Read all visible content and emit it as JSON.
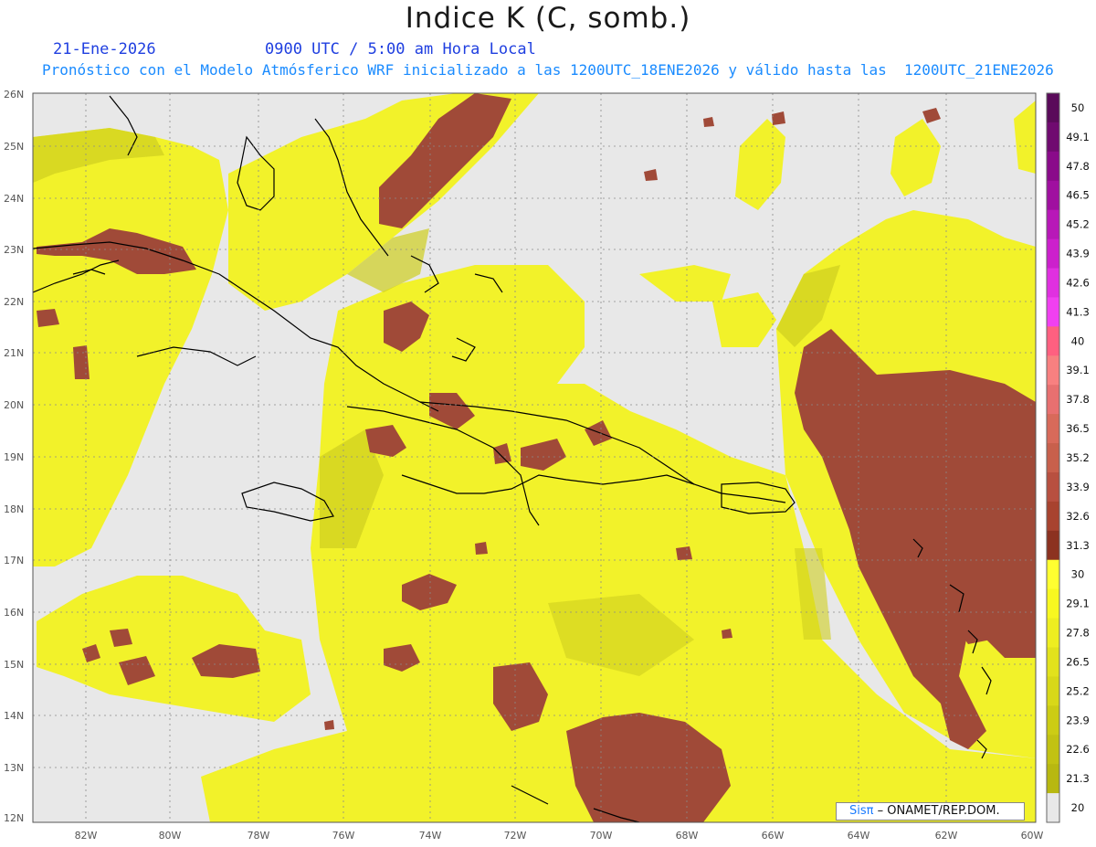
{
  "header": {
    "title": "Indice K (C, somb.)",
    "date": "21-Ene-2026",
    "time": "0900 UTC / 5:00 am Hora Local",
    "subtitle": "Pronóstico con el Modelo Atmósferico WRF inicializado a las 1200UTC_18ENE2026 y válido hasta las  1200UTC_21ENE2026"
  },
  "axes": {
    "lon_labels": [
      "82W",
      "80W",
      "78W",
      "76W",
      "74W",
      "72W",
      "70W",
      "68W",
      "66W",
      "64W",
      "62W",
      "60W"
    ],
    "lat_labels": [
      "26N",
      "25N",
      "24N",
      "23N",
      "22N",
      "21N",
      "20N",
      "19N",
      "18N",
      "17N",
      "16N",
      "15N",
      "14N",
      "13N",
      "12N"
    ]
  },
  "colorbar": {
    "labels": [
      "50",
      "49.1",
      "47.8",
      "46.5",
      "45.2",
      "43.9",
      "42.6",
      "41.3",
      "40",
      "39.1",
      "37.8",
      "36.5",
      "35.2",
      "33.9",
      "32.6",
      "31.3",
      "30",
      "29.1",
      "27.8",
      "26.5",
      "25.2",
      "23.9",
      "22.6",
      "21.3",
      "20"
    ],
    "colors_top_to_bottom": [
      "#5a0a5a",
      "#700a70",
      "#8a0a8a",
      "#a010a0",
      "#b818b8",
      "#cc20cc",
      "#e030e0",
      "#f040f0",
      "#ff6080",
      "#f88080",
      "#e87070",
      "#d86a5a",
      "#c8604c",
      "#b85040",
      "#a8432f",
      "#8c3220",
      "#ffff30",
      "#f8f820",
      "#eeee20",
      "#e2e21c",
      "#d8d818",
      "#cccc14",
      "#c2c212",
      "#b8b810",
      "#e8e8e8"
    ]
  },
  "colors": {
    "background": "#e8e8e8",
    "yellow": "#f2f22a",
    "olive": "#cfcf20",
    "brown": "#a04a38",
    "coast": "#000000"
  },
  "credit": {
    "logo": "Sisπ",
    "text": "– ONAMET/REP.DOM."
  }
}
